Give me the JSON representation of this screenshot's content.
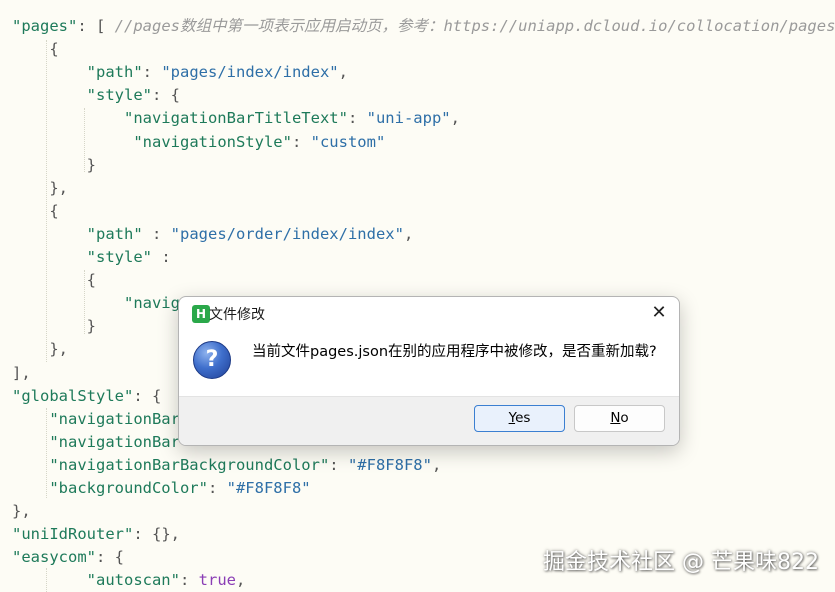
{
  "code": {
    "lines": [
      {
        "tokens": [
          {
            "t": "\"pages\"",
            "c": "k"
          },
          {
            "t": ": [ ",
            "c": "p"
          },
          {
            "t": "//pages数组中第一项表示应用启动页，参考：https://uniapp.dcloud.io/collocation/pages",
            "c": "c"
          }
        ]
      },
      {
        "tokens": [
          {
            "t": "    {",
            "c": "p"
          }
        ]
      },
      {
        "tokens": [
          {
            "t": "        ",
            "c": "p"
          },
          {
            "t": "\"path\"",
            "c": "k"
          },
          {
            "t": ": ",
            "c": "p"
          },
          {
            "t": "\"pages/index/index\"",
            "c": "s"
          },
          {
            "t": ",",
            "c": "p"
          }
        ]
      },
      {
        "tokens": [
          {
            "t": "        ",
            "c": "p"
          },
          {
            "t": "\"style\"",
            "c": "k"
          },
          {
            "t": ": {",
            "c": "p"
          }
        ]
      },
      {
        "tokens": [
          {
            "t": "            ",
            "c": "p"
          },
          {
            "t": "\"navigationBarTitleText\"",
            "c": "k"
          },
          {
            "t": ": ",
            "c": "p"
          },
          {
            "t": "\"uni-app\"",
            "c": "s"
          },
          {
            "t": ",",
            "c": "p"
          }
        ]
      },
      {
        "tokens": [
          {
            "t": "             ",
            "c": "p"
          },
          {
            "t": "\"navigationStyle\"",
            "c": "k"
          },
          {
            "t": ": ",
            "c": "p"
          },
          {
            "t": "\"custom\"",
            "c": "s"
          }
        ]
      },
      {
        "tokens": [
          {
            "t": "        }",
            "c": "p"
          }
        ]
      },
      {
        "tokens": [
          {
            "t": "    },",
            "c": "p"
          }
        ]
      },
      {
        "tokens": [
          {
            "t": "    {",
            "c": "p"
          }
        ]
      },
      {
        "tokens": [
          {
            "t": "        ",
            "c": "p"
          },
          {
            "t": "\"path\"",
            "c": "k"
          },
          {
            "t": " : ",
            "c": "p"
          },
          {
            "t": "\"pages/order/index/index\"",
            "c": "s"
          },
          {
            "t": ",",
            "c": "p"
          }
        ]
      },
      {
        "tokens": [
          {
            "t": "        ",
            "c": "p"
          },
          {
            "t": "\"style\"",
            "c": "k"
          },
          {
            "t": " :",
            "c": "p"
          }
        ]
      },
      {
        "tokens": [
          {
            "t": "        {",
            "c": "p"
          }
        ]
      },
      {
        "tokens": [
          {
            "t": "            ",
            "c": "p"
          },
          {
            "t": "\"naviga",
            "c": "k"
          }
        ]
      },
      {
        "tokens": [
          {
            "t": "        }",
            "c": "p"
          }
        ]
      },
      {
        "tokens": [
          {
            "t": "    },",
            "c": "p"
          }
        ]
      },
      {
        "tokens": [
          {
            "t": "],",
            "c": "p"
          }
        ]
      },
      {
        "tokens": [
          {
            "t": "\"globalStyle\"",
            "c": "k"
          },
          {
            "t": ": {",
            "c": "p"
          }
        ]
      },
      {
        "tokens": [
          {
            "t": "    ",
            "c": "p"
          },
          {
            "t": "\"navigationBar",
            "c": "k"
          }
        ]
      },
      {
        "tokens": [
          {
            "t": "    ",
            "c": "p"
          },
          {
            "t": "\"navigationBar",
            "c": "k"
          }
        ]
      },
      {
        "tokens": [
          {
            "t": "    ",
            "c": "p"
          },
          {
            "t": "\"navigationBarBackgroundColor\"",
            "c": "k"
          },
          {
            "t": ": ",
            "c": "p"
          },
          {
            "t": "\"#F8F8F8\"",
            "c": "s"
          },
          {
            "t": ",",
            "c": "p"
          }
        ]
      },
      {
        "tokens": [
          {
            "t": "    ",
            "c": "p"
          },
          {
            "t": "\"backgroundColor\"",
            "c": "k"
          },
          {
            "t": ": ",
            "c": "p"
          },
          {
            "t": "\"#F8F8F8\"",
            "c": "s"
          }
        ]
      },
      {
        "tokens": [
          {
            "t": "},",
            "c": "p"
          }
        ]
      },
      {
        "tokens": [
          {
            "t": "\"uniIdRouter\"",
            "c": "k"
          },
          {
            "t": ": {},",
            "c": "p"
          }
        ]
      },
      {
        "tokens": [
          {
            "t": "\"easycom\"",
            "c": "k"
          },
          {
            "t": ": {",
            "c": "p"
          }
        ]
      },
      {
        "tokens": [
          {
            "t": "        ",
            "c": "p"
          },
          {
            "t": "\"autoscan\"",
            "c": "k"
          },
          {
            "t": ": ",
            "c": "p"
          },
          {
            "t": "true",
            "c": "b"
          },
          {
            "t": ",",
            "c": "p"
          }
        ]
      }
    ]
  },
  "dialog": {
    "title": "文件修改",
    "app_icon_letter": "H",
    "close_glyph": "✕",
    "question_glyph": "?",
    "message": "当前文件pages.json在别的应用程序中被修改，是否重新加载?",
    "yes_hotkey": "Y",
    "yes_rest": "es",
    "no_hotkey": "N",
    "no_rest": "o"
  },
  "watermark": "掘金技术社区 @ 芒果味822",
  "icons": {
    "app": "hbuilder-app-icon",
    "question": "question-mark-icon",
    "close": "close-icon"
  },
  "colors": {
    "editor_bg": "#fdfcf5",
    "key": "#1e7a5a",
    "string": "#2e6fa7",
    "comment": "#9a9a9a",
    "boolean": "#8a3db5",
    "accent": "#3b7fd1"
  }
}
